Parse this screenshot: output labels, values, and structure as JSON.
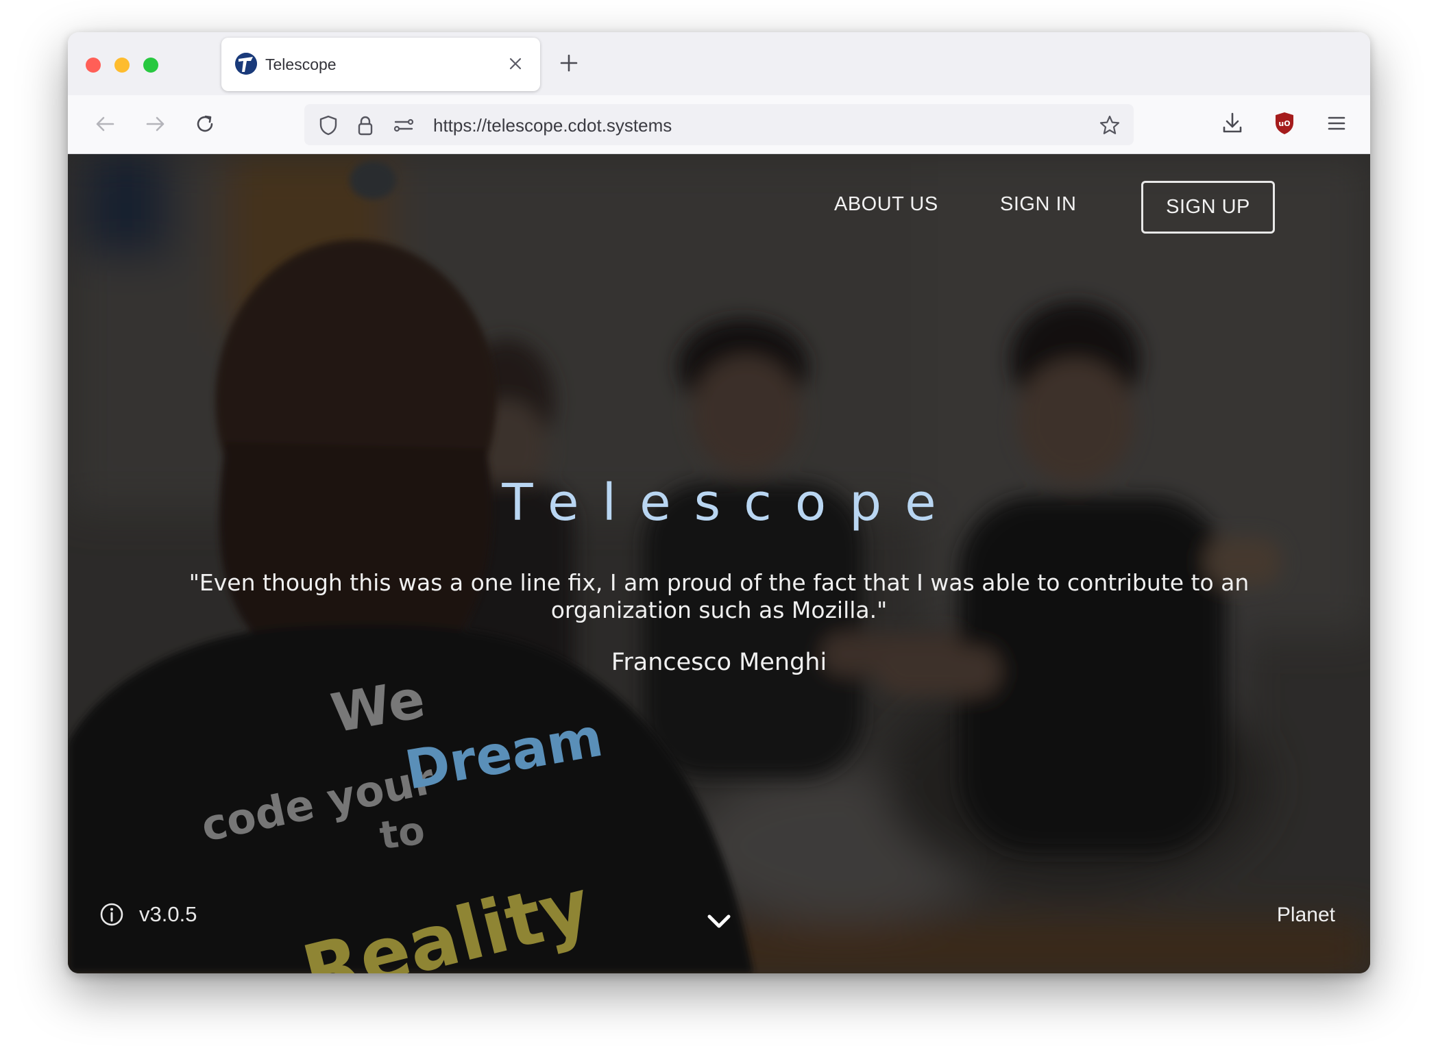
{
  "browser": {
    "tab": {
      "title": "Telescope",
      "favicon": "telescope-logo-icon"
    },
    "url": "https://telescope.cdot.systems",
    "icons": {
      "back": "back-arrow-icon",
      "forward": "forward-arrow-icon",
      "reload": "reload-icon",
      "shield": "tracking-shield-icon",
      "lock": "lock-icon",
      "permissions": "permissions-icon",
      "bookmark": "star-icon",
      "downloads": "download-icon",
      "extension": "ublock-shield-icon",
      "menu": "hamburger-menu-icon"
    }
  },
  "site": {
    "nav": {
      "about": "ABOUT US",
      "signin": "SIGN IN",
      "signup": "SIGN UP"
    },
    "hero": {
      "title": "Telescope",
      "quote": "\"Even though this was a one line fix, I am proud of the fact that I was able to contribute to an organization such as Mozilla.\"",
      "author": "Francesco Menghi"
    },
    "shirt_text": {
      "line1": "We",
      "line2a": "code your",
      "line2b": "Dream",
      "line3": "to",
      "line4": "Reality"
    },
    "footer": {
      "version": "v3.0.5",
      "planet": "Planet"
    },
    "colors": {
      "title": "#b9d6f2",
      "dream": "#5a8fb8",
      "reality": "#8f8534"
    }
  }
}
